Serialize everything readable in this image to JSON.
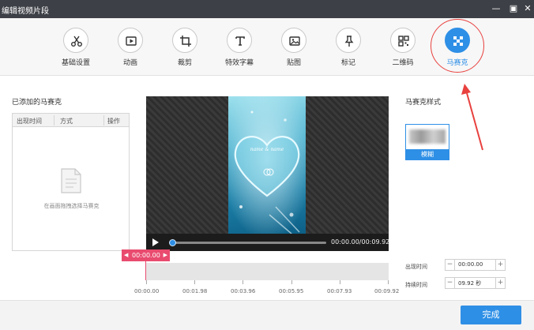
{
  "window": {
    "title": "编辑视频片段",
    "minimize": "—",
    "maximize": "▣",
    "close": "✕"
  },
  "toolbar": {
    "items": [
      {
        "label": "基础设置",
        "icon": "scissors-icon"
      },
      {
        "label": "动画",
        "icon": "animation-icon"
      },
      {
        "label": "裁剪",
        "icon": "crop-icon"
      },
      {
        "label": "特效字幕",
        "icon": "text-icon"
      },
      {
        "label": "贴图",
        "icon": "image-icon"
      },
      {
        "label": "标记",
        "icon": "pin-icon"
      },
      {
        "label": "二维码",
        "icon": "qrcode-icon"
      },
      {
        "label": "马赛克",
        "icon": "mosaic-icon"
      }
    ],
    "active": "马赛克"
  },
  "left_panel": {
    "title": "已添加的马赛克",
    "columns": [
      "出现时间",
      "方式",
      "操作"
    ],
    "empty_text": "在画面拖拽选择马赛克"
  },
  "video": {
    "overlay_text": "name & name",
    "time": "00:00.00/00:09.92",
    "progress": 0
  },
  "timeline": {
    "current": "00:00.00",
    "labels": [
      "00:00.00",
      "00:01.98",
      "00:03.96",
      "00:05.95",
      "00:07.93",
      "00:09.92"
    ]
  },
  "right_panel": {
    "title": "马赛克样式",
    "style_caption": "模糊",
    "appear_label": "出现时间",
    "appear_value": "00:00.00",
    "duration_label": "持续时间",
    "duration_value": "09.92 秒"
  },
  "footer": {
    "done": "完成"
  },
  "colors": {
    "accent": "#2e8fe6",
    "annotation": "#e8413e",
    "playhead": "#e94b6f"
  }
}
